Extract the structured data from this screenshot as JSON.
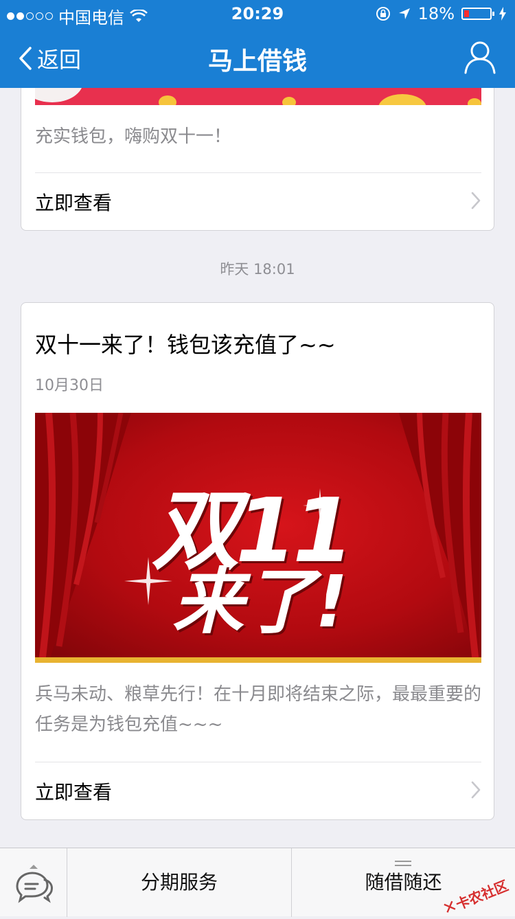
{
  "status": {
    "carrier": "中国电信",
    "time": "20:29",
    "battery": "18%",
    "battery_level": 0.18
  },
  "nav": {
    "back": "返回",
    "title": "马上借钱"
  },
  "card1": {
    "description": "充实钱包，嗨购双十一！",
    "view": "立即查看"
  },
  "timestamp": "昨天 18:01",
  "card2": {
    "title": "双十一来了！钱包该充值了~~",
    "date": "10月30日",
    "banner_line1": "双11",
    "banner_line2": "来了!",
    "description": "兵马未动、粮草先行！在十月即将结束之际，最最重要的任务是为钱包充值~~~",
    "view": "立即查看"
  },
  "tabbar": {
    "tab1": "分期服务",
    "tab2": "随借随还"
  },
  "watermark": "卡农社区",
  "colors": {
    "nav_blue": "#1a7fd4",
    "banner_red": "#c20c12",
    "battery_red": "#ff2d2d"
  }
}
